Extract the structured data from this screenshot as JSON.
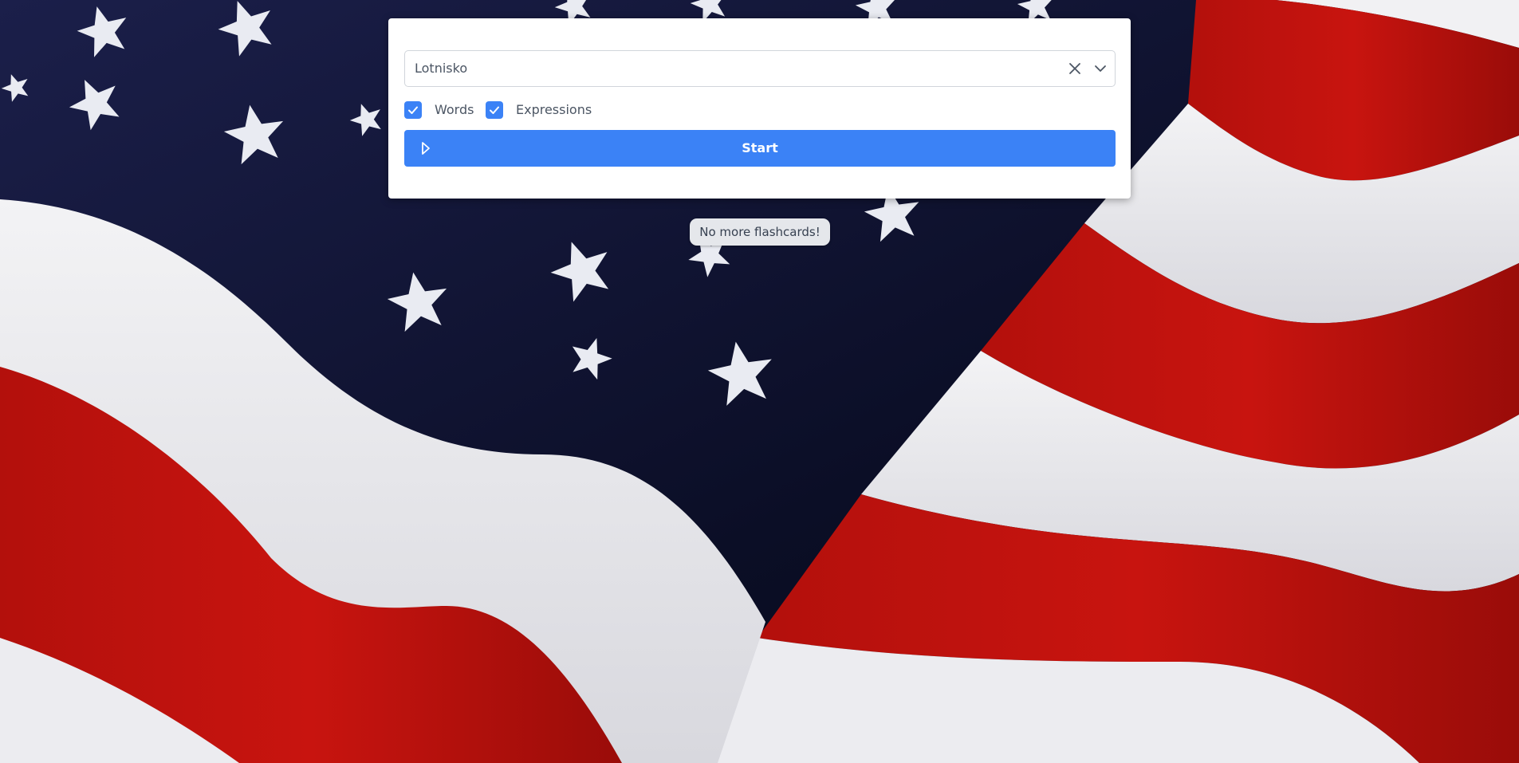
{
  "deck_select": {
    "value": "Lotnisko",
    "clear_icon": "close-icon",
    "toggle_icon": "chevron-down-icon"
  },
  "filters": [
    {
      "label": "Words",
      "checked": true
    },
    {
      "label": "Expressions",
      "checked": true
    }
  ],
  "start_button": {
    "label": "Start",
    "icon": "play-icon"
  },
  "status_message": "No more flashcards!",
  "colors": {
    "accent": "#3b82f6",
    "panel": "#ffffff",
    "toast": "#e5e7eb"
  }
}
